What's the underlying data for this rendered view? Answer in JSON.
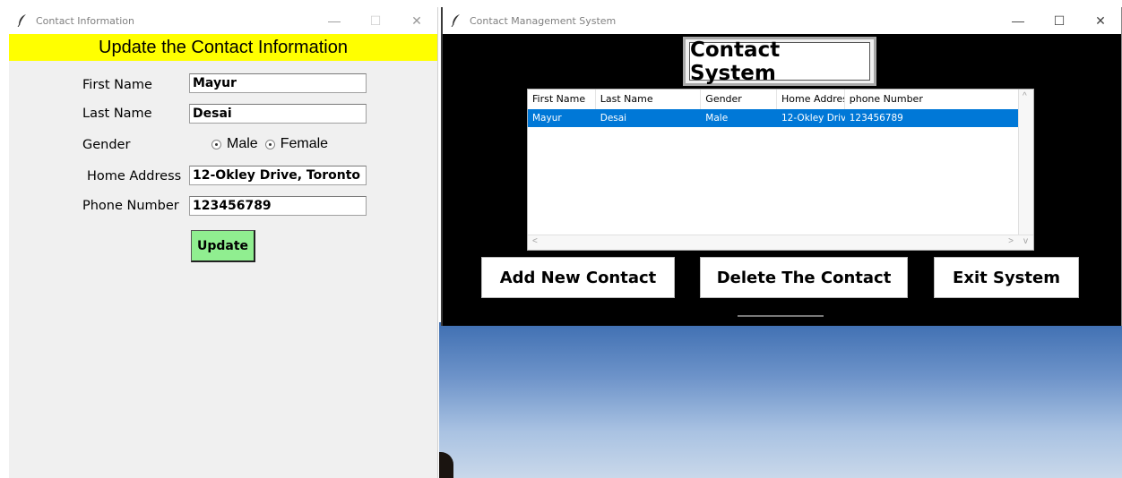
{
  "left_window": {
    "title": "Contact Information",
    "banner": "Update the Contact Information",
    "fields": {
      "first_name_label": "First Name",
      "first_name_value": "Mayur",
      "last_name_label": "Last Name",
      "last_name_value": "Desai",
      "gender_label": "Gender",
      "gender_options": [
        "Male",
        "Female"
      ],
      "home_address_label": "Home Address",
      "home_address_value": "12-Okley Drive, Toronto",
      "phone_label": "Phone Number",
      "phone_value": "123456789"
    },
    "update_button": "Update",
    "colors": {
      "banner": "#ffff00",
      "update_button": "#90ee90"
    }
  },
  "right_window": {
    "title": "Contact Management System",
    "heading": "Contact System",
    "table": {
      "columns": [
        "First Name",
        "Last Name",
        "Gender",
        "Home Addres",
        "phone Number"
      ],
      "rows": [
        [
          "Mayur",
          "Desai",
          "Male",
          "12-Okley Driv",
          "123456789"
        ]
      ],
      "selected_color": "#0078d7"
    },
    "buttons": {
      "add": "Add New Contact",
      "delete": "Delete The Contact",
      "exit": "Exit System"
    }
  },
  "icons": {
    "app": "feather-icon",
    "minimize": "minimize-icon",
    "maximize": "maximize-icon",
    "close": "close-icon"
  }
}
